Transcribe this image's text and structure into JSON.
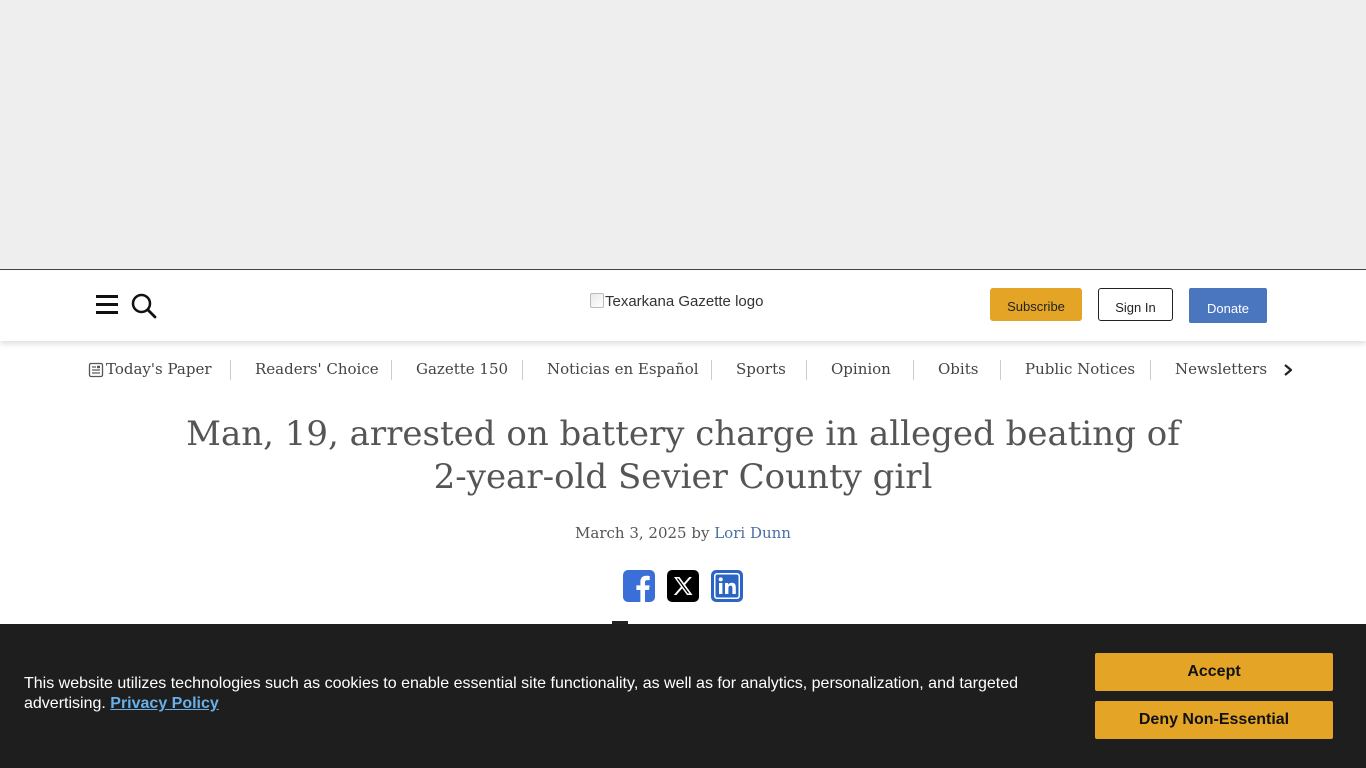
{
  "header": {
    "logo_alt": "Texarkana Gazette logo",
    "subscribe_label": "Subscribe",
    "signin_label": "Sign In",
    "donate_label": "Donate",
    "colors": {
      "subscribe": "#e4a526",
      "donate": "#4a76c0"
    }
  },
  "nav": {
    "items": [
      {
        "label": "Today's Paper",
        "icon": "newspaper-icon"
      },
      {
        "label": "Readers' Choice"
      },
      {
        "label": "Gazette 150"
      },
      {
        "label": "Noticias en Español"
      },
      {
        "label": "Sports"
      },
      {
        "label": "Opinion"
      },
      {
        "label": "Obits"
      },
      {
        "label": "Public Notices"
      },
      {
        "label": "Newsletters"
      }
    ]
  },
  "article": {
    "headline": "Man, 19, arrested on battery charge in alleged beating of 2-year-old Sevier County girl",
    "date": "March 3, 2025",
    "by": "by",
    "author": "Lori Dunn",
    "share_icons": [
      "facebook-icon",
      "x-icon",
      "linkedin-icon"
    ]
  },
  "cookie_banner": {
    "text": "This website utilizes technologies such as cookies to enable essential site functionality, as well as for analytics, personalization, and targeted advertising.",
    "policy_link": "Privacy Policy",
    "accept_label": "Accept",
    "deny_label": "Deny Non-Essential",
    "colors": {
      "background": "#1e1e1e",
      "button": "#e4a526",
      "link": "#6ab0e8"
    }
  }
}
